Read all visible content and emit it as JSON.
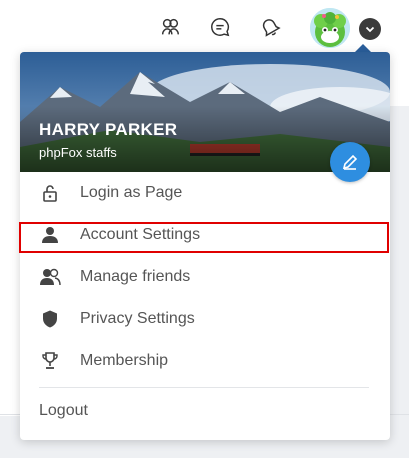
{
  "header": {
    "icons": [
      "friends-icon",
      "chat-icon",
      "notification-bell-icon"
    ],
    "avatar": "user-avatar",
    "dropdown_toggle": "chevron-down-icon"
  },
  "profile": {
    "name": "HARRY PARKER",
    "role": "phpFox staffs",
    "edit_icon": "pencil-icon"
  },
  "menu": {
    "items": [
      {
        "label": "Login as Page",
        "icon": "lock-icon"
      },
      {
        "label": "Account Settings",
        "icon": "user-icon"
      },
      {
        "label": "Manage friends",
        "icon": "users-icon"
      },
      {
        "label": "Privacy Settings",
        "icon": "shield-icon"
      },
      {
        "label": "Membership",
        "icon": "trophy-icon"
      }
    ],
    "logout_label": "Logout"
  },
  "colors": {
    "accent": "#2e8ee0",
    "highlight": "#e00000",
    "text": "#555555",
    "chevron": "#3b3b3b"
  }
}
